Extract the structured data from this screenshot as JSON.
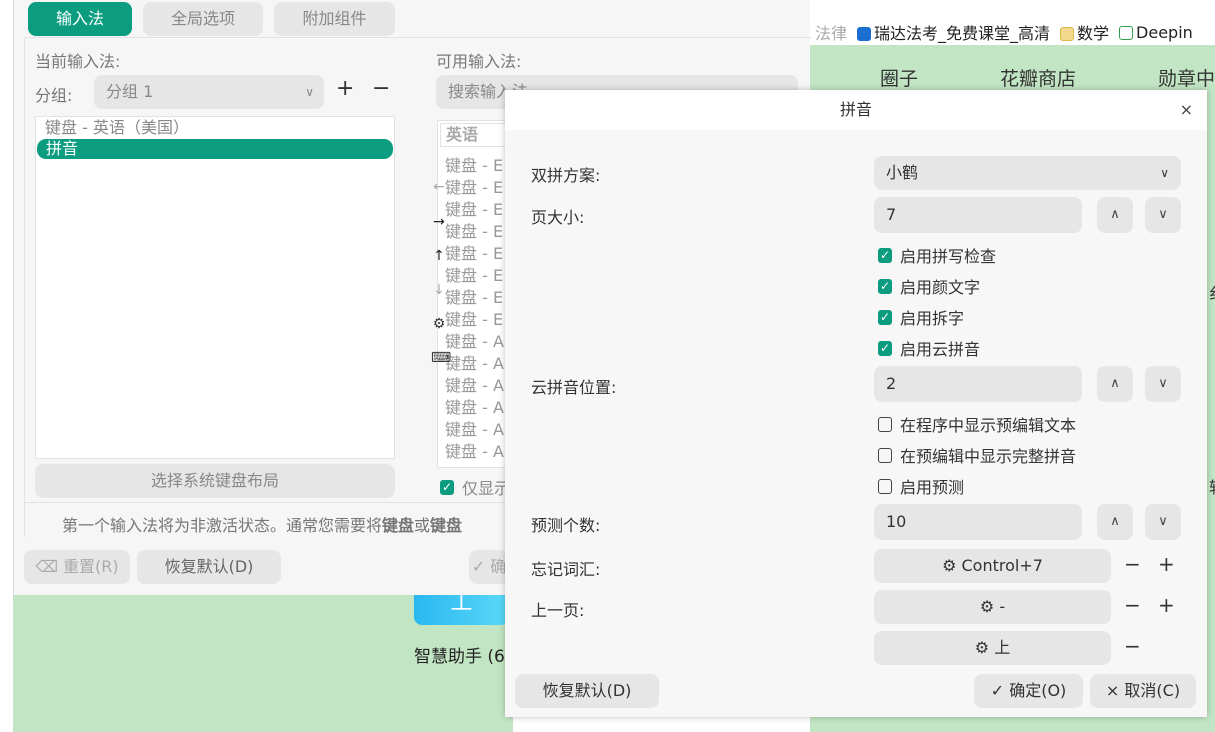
{
  "browser": {
    "bookmarks": [
      {
        "label": "法律",
        "dim": true
      },
      {
        "label": "瑞达法考_免费课堂_高清",
        "icon": "r-logo-icon",
        "color": "#1a6fd1"
      },
      {
        "label": "数学",
        "icon": "folder-icon",
        "color": "#f2c94c"
      },
      {
        "label": "Deepin",
        "icon": "twnz-icon",
        "color": "#2e9e4f"
      }
    ],
    "nav": [
      "圈子",
      "花瓣商店",
      "勋章中"
    ],
    "edge_chars": [
      "纟",
      "轩"
    ],
    "app_tile": {
      "icon_char": "丄",
      "label": "智慧助手 (6"
    }
  },
  "fcitx": {
    "tabs": [
      "输入法",
      "全局选项",
      "附加组件"
    ],
    "current_label": "当前输入法:",
    "available_label": "可用输入法:",
    "group_label": "分组:",
    "group_value": "分组 1",
    "current_items": [
      "键盘 - 英语（美国）",
      "拼音"
    ],
    "search_placeholder": "搜索输入法",
    "available_header": "英语",
    "available_items": [
      "键盘 - E",
      "键盘 - E",
      "键盘 - E",
      "键盘 - E",
      "键盘 - E",
      "键盘 - E",
      "键盘 - E",
      "键盘 - E",
      "键盘 - A",
      "键盘 - A",
      "键盘 - A",
      "键盘 - A",
      "键盘 - A",
      "键盘 - A"
    ],
    "select_layout": "选择系统键盘布局",
    "only_show": "仅显示",
    "hint": "第一个输入法将为非激活状态。通常您需要将",
    "hint_b1": "键盘",
    "hint_or": "或",
    "hint_b2": "键盘",
    "reset": "重置(R)",
    "restore": "恢复默认(D)",
    "ok_partial": "✓ 确"
  },
  "dialog": {
    "title": "拼音",
    "shuangpin_label": "双拼方案:",
    "shuangpin_value": "小鹤",
    "page_size_label": "页大小:",
    "page_size": "7",
    "checks": [
      {
        "label": "启用拼写检查",
        "checked": true
      },
      {
        "label": "启用颜文字",
        "checked": true
      },
      {
        "label": "启用拆字",
        "checked": true
      },
      {
        "label": "启用云拼音",
        "checked": true
      }
    ],
    "cloud_pos_label": "云拼音位置:",
    "cloud_pos": "2",
    "checks2": [
      {
        "label": "在程序中显示预编辑文本",
        "checked": false
      },
      {
        "label": "在预编辑中显示完整拼音",
        "checked": false
      },
      {
        "label": "启用预测",
        "checked": false
      }
    ],
    "predict_label": "预测个数:",
    "predict": "10",
    "forget_label": "忘记词汇:",
    "forget_key": "Control+7",
    "prev_label": "上一页:",
    "prev_keys": [
      "-",
      "上"
    ],
    "restore": "恢复默认(D)",
    "ok": "✓ 确定(O)",
    "cancel": "× 取消(C)"
  }
}
